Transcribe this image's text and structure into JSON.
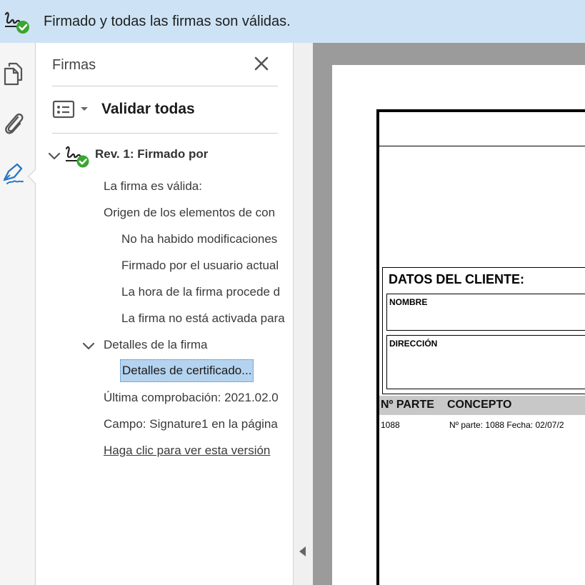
{
  "banner": {
    "message": "Firmado y todas las firmas son válidas."
  },
  "rail": {
    "icons": [
      "pages-icon",
      "attachment-icon",
      "signature-pen-icon"
    ]
  },
  "panel": {
    "title": "Firmas",
    "validate_all": "Validar todas",
    "revision": {
      "label": "Rev. 1: Firmado por"
    },
    "items": [
      "La firma es válida:",
      "Origen de los elementos de con",
      "No ha habido modificaciones",
      "Firmado por el usuario actual",
      "La hora de la firma procede d",
      "La firma no está activada para",
      "Detalles de la firma",
      "Detalles de certificado...",
      "Última comprobación: 2021.02.0",
      "Campo: Signature1 en la página",
      "Haga clic para ver esta versión"
    ]
  },
  "document": {
    "client_title": "DATOS DEL CLIENTE:",
    "name_label": "NOMBRE",
    "address_label": "DIRECCIÓN",
    "parts_header": {
      "col1": "Nº PARTE",
      "col2": "CONCEPTO"
    },
    "parts_row": {
      "number": "1088",
      "concept": "Nº parte: 1088  Fecha: 02/07/2"
    }
  },
  "colors": {
    "banner_bg": "#cde3f5",
    "valid_green": "#3aa52f",
    "selection": "#b4d3ef",
    "accent_blue": "#2b78c5"
  }
}
